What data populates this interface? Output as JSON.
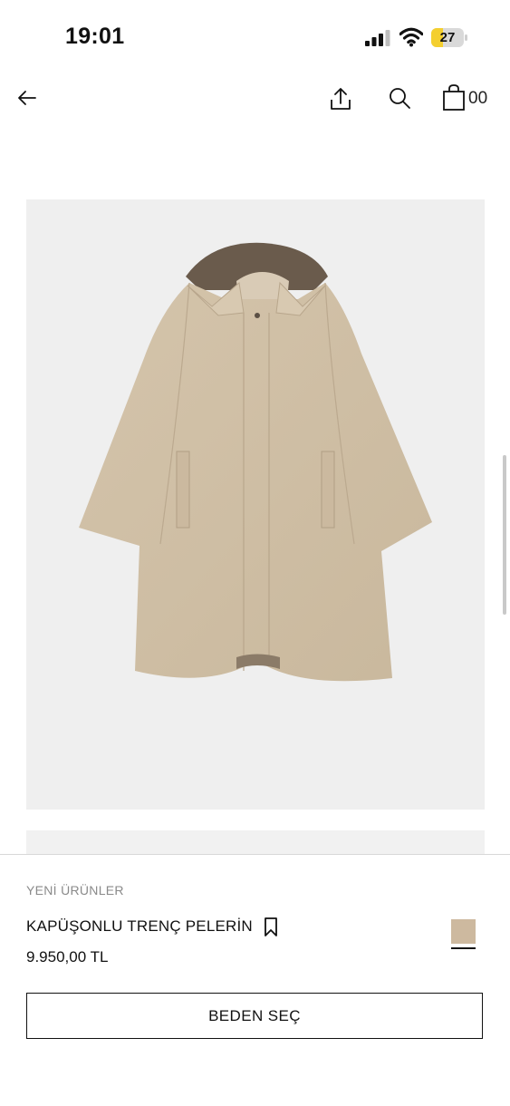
{
  "status_bar": {
    "time": "19:01",
    "battery": "27"
  },
  "nav": {
    "bag_count": "00"
  },
  "product": {
    "collection_label": "YENİ ÜRÜNLER",
    "name": "KAPÜŞONLU TRENÇ PELERİN",
    "price": "9.950,00 TL",
    "color_swatch": "#cdb99f",
    "select_size_label": "BEDEN SEÇ"
  },
  "icons": [
    "back-arrow-icon",
    "share-icon",
    "search-icon",
    "shopping-bag-icon",
    "bookmark-icon",
    "signal-icon",
    "wifi-icon",
    "battery-icon"
  ]
}
